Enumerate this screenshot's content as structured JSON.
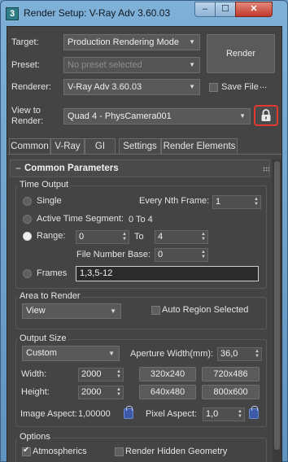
{
  "window": {
    "app_icon": "3",
    "title": "Render Setup: V-Ray Adv 3.60.03",
    "minimize": "–",
    "maximize": "☐",
    "close": "✕"
  },
  "top": {
    "target_label": "Target:",
    "target_value": "Production Rendering Mode",
    "preset_label": "Preset:",
    "preset_value": "No preset selected",
    "renderer_label": "Renderer:",
    "renderer_value": "V-Ray Adv 3.60.03",
    "render_button": "Render",
    "save_file_label": "Save File",
    "more_button": "...",
    "view_label_1": "View to",
    "view_label_2": "Render:",
    "view_value": "Quad 4 - PhysCamera001",
    "lock_icon": "lock-icon",
    "accent_highlight": "#e03a2f"
  },
  "tabs": [
    "Common",
    "V-Ray",
    "GI",
    "Settings",
    "Render Elements"
  ],
  "rollout": {
    "title": "Common Parameters",
    "collapse_glyph": "−"
  },
  "time_output": {
    "title": "Time Output",
    "single": "Single",
    "every_nth_label": "Every Nth Frame:",
    "every_nth_value": "1",
    "active_segment": "Active Time Segment:",
    "active_segment_value": "0 To 4",
    "range": "Range:",
    "range_from": "0",
    "range_to_label": "To",
    "range_to": "4",
    "file_number_base_label": "File Number Base:",
    "file_number_base_value": "0",
    "frames": "Frames",
    "frames_value": "1,3,5-12"
  },
  "area": {
    "title": "Area to Render",
    "value": "View",
    "auto_region": "Auto Region Selected"
  },
  "output_size": {
    "title": "Output Size",
    "preset_value": "Custom",
    "aperture_label": "Aperture Width(mm):",
    "aperture_value": "36,0",
    "width_label": "Width:",
    "width_value": "2000",
    "height_label": "Height:",
    "height_value": "2000",
    "preset_buttons": [
      "320x240",
      "720x486",
      "640x480",
      "800x600"
    ],
    "image_aspect_label": "Image Aspect:",
    "image_aspect_value": "1,00000",
    "pixel_aspect_label": "Pixel Aspect:",
    "pixel_aspect_value": "1,0"
  },
  "options": {
    "title": "Options",
    "atmospherics": "Atmospherics",
    "render_hidden": "Render Hidden Geometry"
  }
}
